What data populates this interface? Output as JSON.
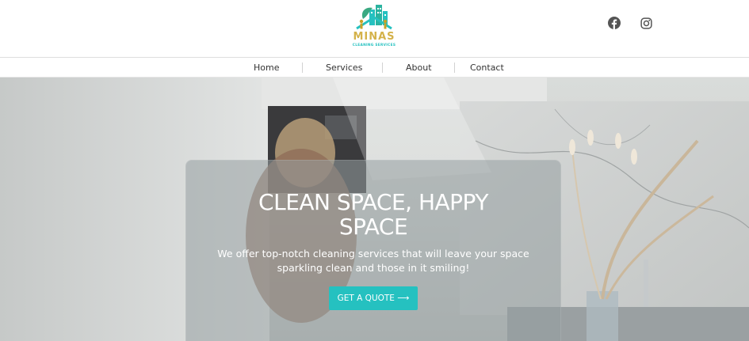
{
  "brand": {
    "name": "MINAS",
    "tagline": "CLEANING SERVICES",
    "colors": {
      "teal": "#25c1c0",
      "gold": "#c9a227"
    }
  },
  "social": [
    {
      "icon": "facebook-icon"
    },
    {
      "icon": "instagram-icon"
    }
  ],
  "nav": {
    "items": [
      "Home",
      "Services",
      "About",
      "Contact"
    ]
  },
  "hero": {
    "title_line1": "CLEAN SPACE, HAPPY",
    "title_line2": "SPACE",
    "subtitle_line1": "We offer top-notch cleaning services that will leave your space",
    "subtitle_line2": "sparkling clean and those in it smiling!",
    "cta_label": "GET A QUOTE ⟶"
  }
}
